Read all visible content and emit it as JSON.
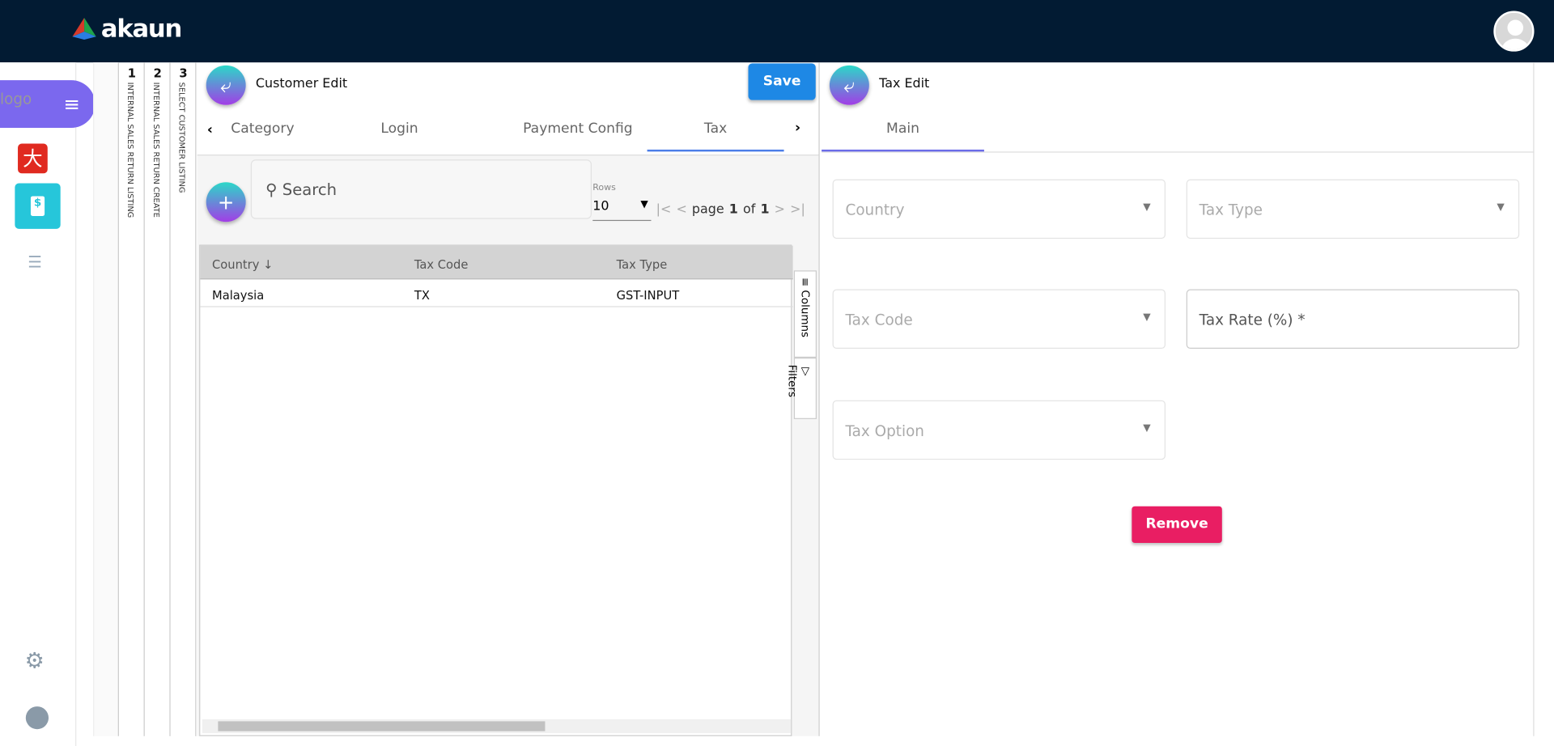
{
  "header": {
    "brand": "akaun"
  },
  "sidebar": {
    "logo_alt": "logo",
    "icons": [
      "menu-toggle-icon",
      "app-red-icon",
      "invoice-dollar-icon",
      "list-icon",
      "gear-icon",
      "user-icon"
    ]
  },
  "breadcrumb_strips": [
    {
      "num": "1",
      "label": "INTERNAL SALES RETURN LISTING"
    },
    {
      "num": "2",
      "label": "INTERNAL SALES RETURN CREATE"
    },
    {
      "num": "3",
      "label": "SELECT CUSTOMER LISTING"
    }
  ],
  "customer_edit": {
    "title": "Customer Edit",
    "save": "Save",
    "tabs": [
      "Category",
      "Login",
      "Payment Config",
      "Tax"
    ],
    "active_tab": "Tax",
    "search_placeholder": "Search",
    "rows_label": "Rows",
    "rows_value": "10",
    "page_label": "page",
    "page": "1",
    "of_label": "of",
    "total_pages": "1",
    "columns": [
      "Country",
      "Tax Code",
      "Tax Type"
    ],
    "rows": [
      [
        "Malaysia",
        "TX",
        "GST-INPUT"
      ]
    ],
    "side_columns": "Columns",
    "side_filters": "Filters"
  },
  "tax_edit": {
    "title": "Tax Edit",
    "tabs": [
      "Main"
    ],
    "fields": {
      "country": "Country",
      "tax_type": "Tax Type",
      "tax_code": "Tax Code",
      "tax_rate": "Tax Rate (%) *",
      "tax_option": "Tax Option"
    },
    "remove": "Remove"
  },
  "colors": {
    "header": "#021b33",
    "accent": "#7b68ee",
    "save": "#1e88e5",
    "remove": "#e91e63"
  }
}
